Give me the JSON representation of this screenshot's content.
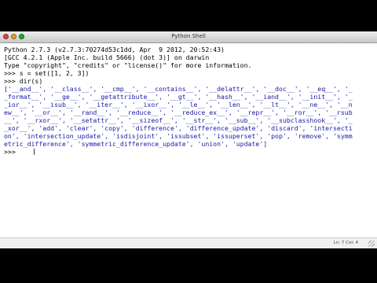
{
  "window": {
    "title": "Python Shell"
  },
  "shell": {
    "banner": [
      "Python 2.7.3 (v2.7.3:70274d53c1dd, Apr  9 2012, 20:52:43)",
      "[GCC 4.2.1 (Apple Inc. build 5666) (dot 3)] on darwin",
      "Type \"copyright\", \"credits\" or \"license()\" for more information."
    ],
    "cmd1_prompt": ">>> ",
    "cmd1": "s = set([1, 2, 3])",
    "cmd2_prompt": ">>> ",
    "cmd2": "dir(s)",
    "output": [
      "['__and__', '__class__', '__cmp__', '__contains__', '__delattr__', '__doc__', '__eq__', '_",
      "_format__', '__ge__', '__getattribute__', '__gt__', '__hash__', '__iand__', '__init__', '_",
      "_ior__', '__isub__', '__iter__', '__ixor__', '__le__', '__len__', '__lt__', '__ne__', '__n",
      "ew__', '__or__', '__rand__', '__reduce__', '__reduce_ex__', '__repr__', '__ror__', '__rsub",
      "__', '__rxor__', '__setattr__', '__sizeof__', '__str__', '__sub__', '__subclasshook__', '_",
      "_xor__', 'add', 'clear', 'copy', 'difference', 'difference_update', 'discard', 'intersecti",
      "on', 'intersection_update', 'isdisjoint', 'issubset', 'issuperset', 'pop', 'remove', 'symm",
      "etric_difference', 'symmetric_difference_update', 'union', 'update']"
    ],
    "final_prompt": ">>> "
  },
  "status": {
    "position": "Ln: 7 Col: 4"
  },
  "colors": {
    "output": "#1a1aa6",
    "background": "#ffffff"
  }
}
